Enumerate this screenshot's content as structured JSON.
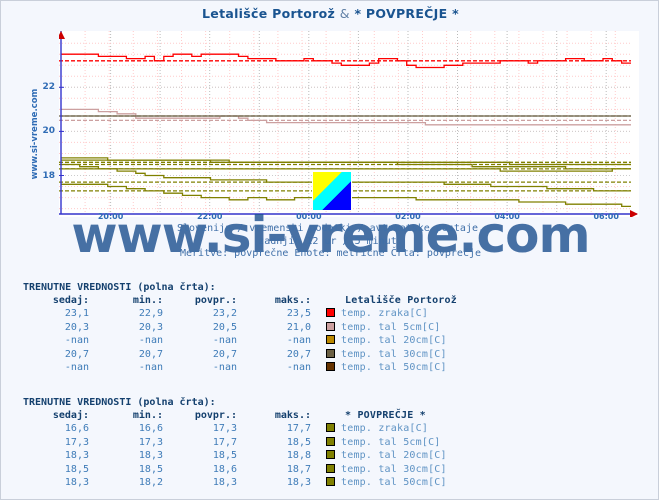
{
  "window": {
    "site_vertical_text": "www.si-vreme.com",
    "watermark": "www.si-vreme.com"
  },
  "header": {
    "title_left": "Letališče Portorož",
    "title_sep": "&",
    "title_right": "* POVPREČJE *"
  },
  "subtitle": {
    "line1": "Slovenija / vremenski podatki / avtomatske postaje.",
    "line2": "zadnjih 12 ur / 5 minut.",
    "line3": "Meritve: povprečne  Enote: metrične  Črta: povprečje"
  },
  "chart_data": {
    "type": "line",
    "title": "Letališče Portorož & * POVPREČJE *",
    "xlabel": "",
    "ylabel": "",
    "ylim": [
      16.3,
      24.1
    ],
    "yticks": [
      18,
      20,
      22
    ],
    "xticks": [
      "20:00",
      "22:00",
      "00:00",
      "02:00",
      "04:00",
      "06:00"
    ],
    "grid": true,
    "legend_position": "below",
    "series": [
      {
        "name": "Letališče Portorož temp. zraka[C]",
        "color": "#ff0000",
        "style": "solid",
        "avg_line": 23.2,
        "values": [
          23.5,
          23.5,
          23.5,
          23.5,
          23.4,
          23.4,
          23.4,
          23.3,
          23.3,
          23.4,
          23.2,
          23.4,
          23.5,
          23.5,
          23.4,
          23.5,
          23.5,
          23.5,
          23.5,
          23.4,
          23.3,
          23.3,
          23.3,
          23.2,
          23.2,
          23.2,
          23.3,
          23.2,
          23.2,
          23.1,
          23.0,
          23.0,
          23.0,
          23.1,
          23.3,
          23.3,
          23.2,
          23.0,
          22.9,
          22.9,
          22.9,
          23.0,
          23.0,
          23.1,
          23.1,
          23.1,
          23.1,
          23.2,
          23.2,
          23.2,
          23.1,
          23.2,
          23.2,
          23.2,
          23.3,
          23.3,
          23.2,
          23.2,
          23.3,
          23.2,
          23.1,
          23.1
        ]
      },
      {
        "name": "Letališče Portorož temp. tal  5cm[C]",
        "color": "#cca0a0",
        "style": "solid",
        "avg_line": 20.5,
        "values": [
          21.0,
          21.0,
          21.0,
          21.0,
          20.9,
          20.9,
          20.8,
          20.8,
          20.6,
          20.6,
          20.6,
          20.6,
          20.6,
          20.6,
          20.6,
          20.6,
          20.6,
          20.7,
          20.7,
          20.6,
          20.5,
          20.5,
          20.4,
          20.4,
          20.4,
          20.4,
          20.4,
          20.4,
          20.4,
          20.4,
          20.4,
          20.4,
          20.4,
          20.4,
          20.4,
          20.4,
          20.4,
          20.4,
          20.4,
          20.3,
          20.3,
          20.3,
          20.3,
          20.3,
          20.3,
          20.3,
          20.3,
          20.3,
          20.3,
          20.3,
          20.3,
          20.3,
          20.3,
          20.3,
          20.3,
          20.3,
          20.3,
          20.3,
          20.3,
          20.3,
          20.3,
          20.3
        ]
      },
      {
        "name": "Letališče Portorož temp. tal 20cm[C]",
        "color": "#bb8800",
        "style": "solid",
        "avg_line": null,
        "values": []
      },
      {
        "name": "Letališče Portorož temp. tal 30cm[C]",
        "color": "#6b6044",
        "style": "solid",
        "avg_line": 20.7,
        "values": [
          20.7,
          20.7,
          20.7,
          20.7,
          20.7,
          20.7,
          20.7,
          20.7,
          20.7,
          20.7,
          20.7,
          20.7,
          20.7,
          20.7,
          20.7,
          20.7,
          20.7,
          20.7,
          20.7,
          20.7,
          20.7,
          20.7,
          20.7,
          20.7,
          20.7,
          20.7,
          20.7,
          20.7,
          20.7,
          20.7,
          20.7,
          20.7,
          20.7,
          20.7,
          20.7,
          20.7,
          20.7,
          20.7,
          20.7,
          20.7,
          20.7,
          20.7,
          20.7,
          20.7,
          20.7,
          20.7,
          20.7,
          20.7,
          20.7,
          20.7,
          20.7,
          20.7,
          20.7,
          20.7,
          20.7,
          20.7,
          20.7,
          20.7,
          20.7,
          20.7,
          20.7,
          20.7
        ]
      },
      {
        "name": "Letališče Portorož temp. tal 50cm[C]",
        "color": "#663300",
        "style": "solid",
        "avg_line": null,
        "values": []
      },
      {
        "name": "* POVPREČJE * temp. zraka[C]",
        "color": "#808000",
        "style": "solid",
        "avg_line": 17.3,
        "values": [
          17.6,
          17.6,
          17.6,
          17.6,
          17.6,
          17.5,
          17.5,
          17.4,
          17.4,
          17.3,
          17.3,
          17.2,
          17.2,
          17.1,
          17.1,
          17.0,
          17.0,
          17.0,
          16.9,
          16.9,
          17.0,
          17.0,
          16.9,
          16.9,
          16.9,
          17.0,
          17.0,
          17.0,
          17.0,
          17.0,
          17.0,
          17.0,
          17.0,
          17.0,
          17.0,
          17.0,
          17.0,
          17.0,
          16.9,
          16.9,
          16.9,
          16.9,
          16.9,
          16.9,
          16.9,
          16.9,
          16.9,
          16.9,
          16.9,
          16.8,
          16.8,
          16.8,
          16.8,
          16.8,
          16.7,
          16.7,
          16.7,
          16.7,
          16.7,
          16.7,
          16.6,
          16.6
        ]
      },
      {
        "name": "* POVPREČJE * temp. tal  5cm[C]",
        "color": "#808000",
        "style": "solid",
        "avg_line": 17.7,
        "values": [
          18.5,
          18.5,
          18.4,
          18.4,
          18.3,
          18.3,
          18.2,
          18.2,
          18.1,
          18.0,
          18.0,
          17.9,
          17.9,
          17.9,
          17.9,
          17.9,
          17.8,
          17.8,
          17.8,
          17.8,
          17.8,
          17.8,
          17.7,
          17.7,
          17.7,
          17.7,
          17.7,
          17.7,
          17.7,
          17.7,
          17.7,
          17.7,
          17.7,
          17.7,
          17.7,
          17.7,
          17.7,
          17.7,
          17.7,
          17.7,
          17.7,
          17.6,
          17.6,
          17.6,
          17.6,
          17.6,
          17.5,
          17.5,
          17.5,
          17.5,
          17.5,
          17.5,
          17.4,
          17.4,
          17.4,
          17.4,
          17.4,
          17.3,
          17.3,
          17.3,
          17.3,
          17.3
        ]
      },
      {
        "name": "* POVPREČJE * temp. tal 20cm[C]",
        "color": "#808000",
        "style": "solid",
        "avg_line": 18.5,
        "values": [
          18.8,
          18.8,
          18.8,
          18.8,
          18.8,
          18.7,
          18.7,
          18.7,
          18.7,
          18.7,
          18.7,
          18.7,
          18.7,
          18.7,
          18.7,
          18.7,
          18.6,
          18.6,
          18.6,
          18.6,
          18.6,
          18.6,
          18.6,
          18.6,
          18.6,
          18.6,
          18.6,
          18.6,
          18.6,
          18.6,
          18.6,
          18.6,
          18.6,
          18.6,
          18.6,
          18.6,
          18.5,
          18.5,
          18.5,
          18.5,
          18.5,
          18.5,
          18.5,
          18.5,
          18.4,
          18.4,
          18.4,
          18.4,
          18.4,
          18.4,
          18.4,
          18.4,
          18.4,
          18.4,
          18.3,
          18.3,
          18.3,
          18.3,
          18.3,
          18.3,
          18.3,
          18.3
        ]
      },
      {
        "name": "* POVPREČJE * temp. tal 30cm[C]",
        "color": "#808000",
        "style": "solid",
        "avg_line": 18.6,
        "values": [
          18.7,
          18.7,
          18.7,
          18.7,
          18.7,
          18.7,
          18.7,
          18.7,
          18.7,
          18.7,
          18.7,
          18.7,
          18.7,
          18.7,
          18.7,
          18.7,
          18.7,
          18.7,
          18.6,
          18.6,
          18.6,
          18.6,
          18.6,
          18.6,
          18.6,
          18.6,
          18.6,
          18.6,
          18.6,
          18.6,
          18.6,
          18.6,
          18.6,
          18.6,
          18.6,
          18.6,
          18.6,
          18.6,
          18.6,
          18.6,
          18.6,
          18.6,
          18.6,
          18.6,
          18.6,
          18.6,
          18.6,
          18.6,
          18.5,
          18.5,
          18.5,
          18.5,
          18.5,
          18.5,
          18.5,
          18.5,
          18.5,
          18.5,
          18.5,
          18.5,
          18.5,
          18.5
        ]
      },
      {
        "name": "* POVPREČJE * temp. tal 50cm[C]",
        "color": "#808000",
        "style": "solid",
        "avg_line": 18.3,
        "values": [
          18.3,
          18.3,
          18.3,
          18.3,
          18.3,
          18.3,
          18.3,
          18.3,
          18.3,
          18.3,
          18.3,
          18.3,
          18.3,
          18.3,
          18.3,
          18.3,
          18.3,
          18.3,
          18.3,
          18.3,
          18.3,
          18.3,
          18.3,
          18.3,
          18.3,
          18.3,
          18.3,
          18.3,
          18.3,
          18.3,
          18.3,
          18.3,
          18.3,
          18.3,
          18.3,
          18.3,
          18.3,
          18.3,
          18.3,
          18.3,
          18.3,
          18.3,
          18.3,
          18.3,
          18.3,
          18.3,
          18.3,
          18.2,
          18.2,
          18.2,
          18.2,
          18.2,
          18.2,
          18.2,
          18.2,
          18.2,
          18.2,
          18.2,
          18.2,
          18.3,
          18.3,
          18.3
        ]
      }
    ]
  },
  "legend_tables": [
    {
      "heading": "TRENUTNE VREDNOSTI (polna črta):",
      "columns": [
        "sedaj:",
        "min.:",
        "povpr.:",
        "maks.:"
      ],
      "station": "Letališče Portorož",
      "rows": [
        {
          "sedaj": "23,1",
          "min": "22,9",
          "povpr": "23,2",
          "maks": "23,5",
          "color": "#ff0000",
          "name": "temp. zraka[C]"
        },
        {
          "sedaj": "20,3",
          "min": "20,3",
          "povpr": "20,5",
          "maks": "21,0",
          "color": "#cca0a0",
          "name": "temp. tal  5cm[C]"
        },
        {
          "sedaj": "-nan",
          "min": "-nan",
          "povpr": "-nan",
          "maks": "-nan",
          "color": "#bb8800",
          "name": "temp. tal 20cm[C]"
        },
        {
          "sedaj": "20,7",
          "min": "20,7",
          "povpr": "20,7",
          "maks": "20,7",
          "color": "#6b6044",
          "name": "temp. tal 30cm[C]"
        },
        {
          "sedaj": "-nan",
          "min": "-nan",
          "povpr": "-nan",
          "maks": "-nan",
          "color": "#663300",
          "name": "temp. tal 50cm[C]"
        }
      ]
    },
    {
      "heading": "TRENUTNE VREDNOSTI (polna črta):",
      "columns": [
        "sedaj:",
        "min.:",
        "povpr.:",
        "maks.:"
      ],
      "station": "* POVPREČJE *",
      "rows": [
        {
          "sedaj": "16,6",
          "min": "16,6",
          "povpr": "17,3",
          "maks": "17,7",
          "color": "#808000",
          "name": "temp. zraka[C]"
        },
        {
          "sedaj": "17,3",
          "min": "17,3",
          "povpr": "17,7",
          "maks": "18,5",
          "color": "#808000",
          "name": "temp. tal  5cm[C]"
        },
        {
          "sedaj": "18,3",
          "min": "18,3",
          "povpr": "18,5",
          "maks": "18,8",
          "color": "#808000",
          "name": "temp. tal 20cm[C]"
        },
        {
          "sedaj": "18,5",
          "min": "18,5",
          "povpr": "18,6",
          "maks": "18,7",
          "color": "#808000",
          "name": "temp. tal 30cm[C]"
        },
        {
          "sedaj": "18,3",
          "min": "18,2",
          "povpr": "18,3",
          "maks": "18,3",
          "color": "#808000",
          "name": "temp. tal 50cm[C]"
        }
      ]
    }
  ],
  "flag": {
    "c1": "#ffff00",
    "c2": "#00ffff",
    "c3": "#0000ff"
  }
}
